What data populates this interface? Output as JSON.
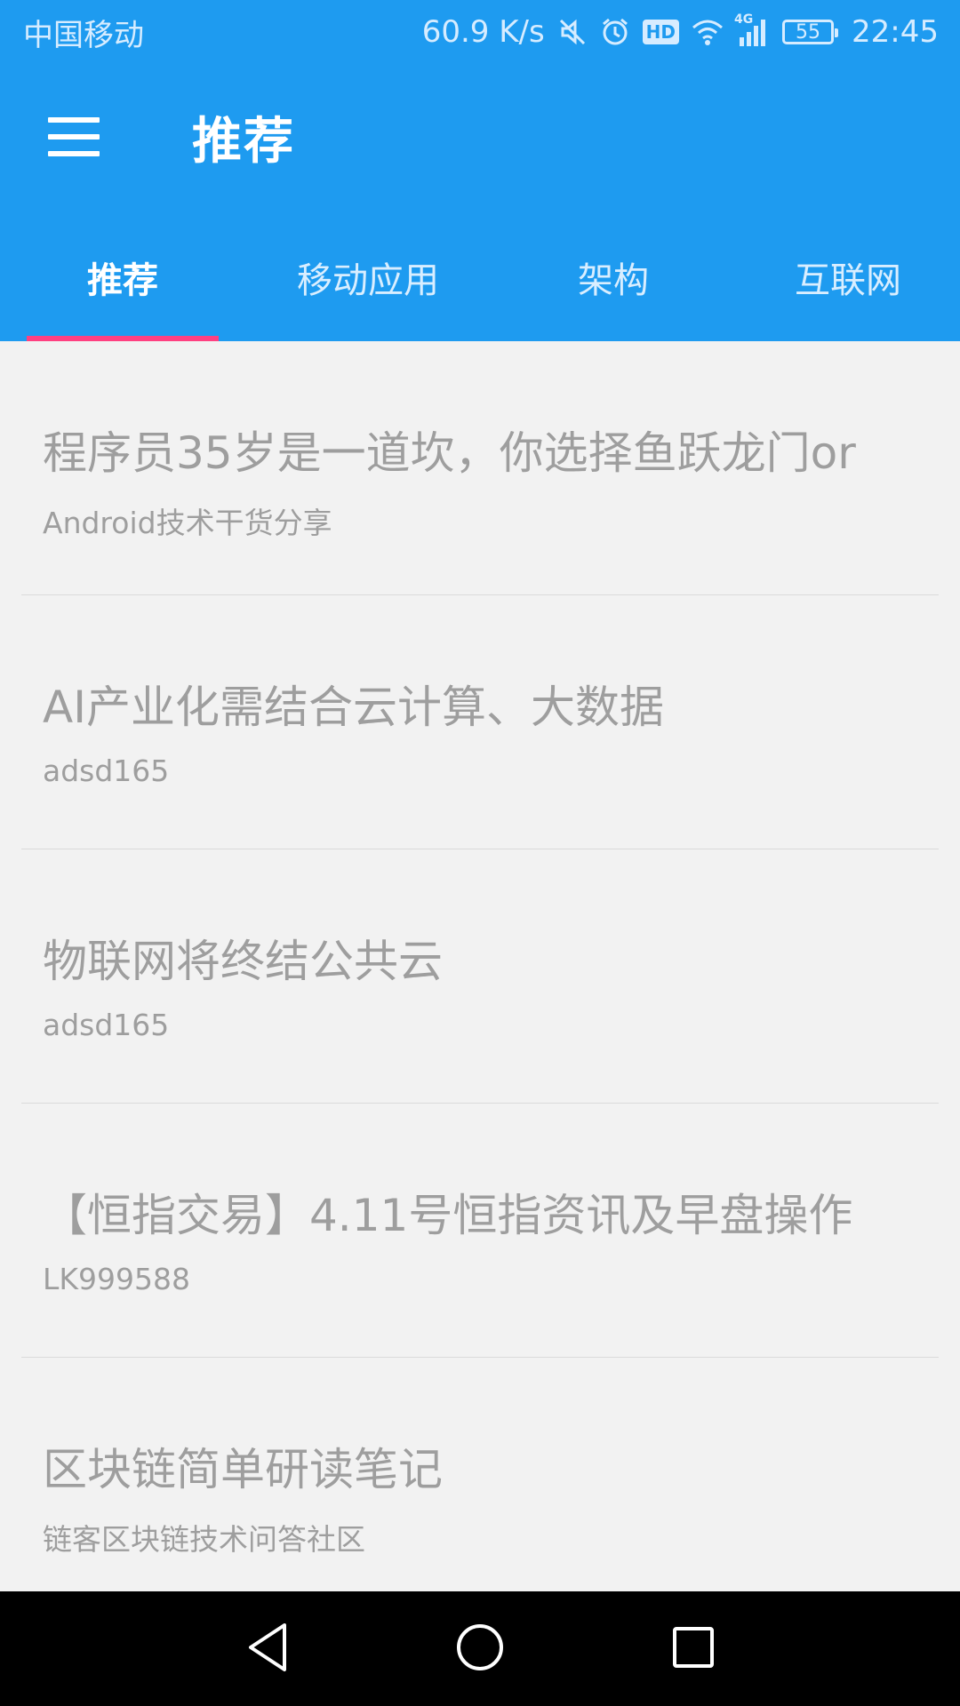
{
  "status_bar": {
    "carrier": "中国移动",
    "net_speed": "60.9 K/s",
    "hd_label": "HD",
    "network_label": "4G",
    "battery": "55",
    "time": "22:45"
  },
  "toolbar": {
    "title": "推荐"
  },
  "tabs": [
    {
      "label": "推荐",
      "active": true
    },
    {
      "label": "移动应用",
      "active": false
    },
    {
      "label": "架构",
      "active": false
    },
    {
      "label": "互联网",
      "active": false
    }
  ],
  "feed": [
    {
      "title": "程序员35岁是一道坎，你选择鱼跃龙门or",
      "author": "Android技术干货分享"
    },
    {
      "title": "AI产业化需结合云计算、大数据",
      "author": "adsd165"
    },
    {
      "title": "物联网将终结公共云",
      "author": "adsd165"
    },
    {
      "title": "【恒指交易】4.11号恒指资讯及早盘操作",
      "author": "LK999588"
    },
    {
      "title": "区块链简单研读笔记",
      "author": "链客区块链技术问答社区"
    }
  ],
  "icons": {
    "status": [
      "mute-icon",
      "alarm-icon",
      "hd-icon",
      "wifi-icon",
      "signal-icon",
      "battery-icon"
    ],
    "nav": [
      "back-icon",
      "home-icon",
      "recents-icon"
    ]
  },
  "colors": {
    "primary": "#1e9bf0",
    "indicator": "#ff4081",
    "text_muted": "#9e9e9e",
    "background": "#f2f2f2"
  }
}
